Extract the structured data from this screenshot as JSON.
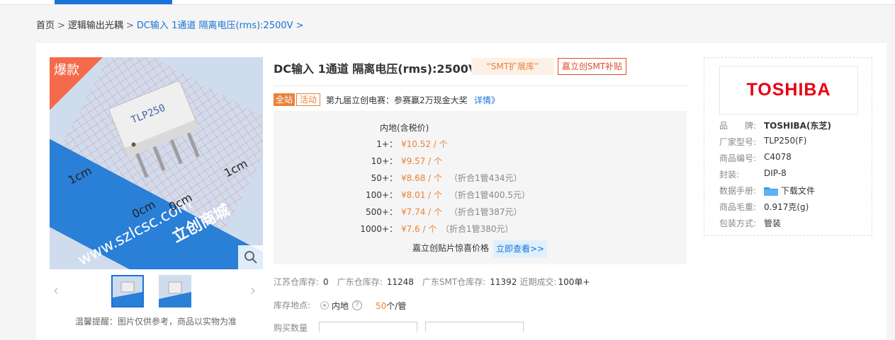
{
  "breadcrumb": {
    "home": "首页",
    "category": "逻辑输出光耦",
    "current": "DC输入 1通道 隔离电压(rms):2500V",
    "sep": ">"
  },
  "product": {
    "title": "DC输入 1通道 隔离电压(rms):2500V",
    "tag_smt": "“SMT扩展库”",
    "tag_subsidy": "嘉立创SMT补贴",
    "hot_badge": "爆款",
    "image_note": "温馨提醒：图片仅供参考，商品以实物为准",
    "image_watermark": "www.szlcsc.com",
    "image_watermark_cn": "立创商城",
    "chip_marking": "TLP250",
    "ruler_labels": [
      "1cm",
      "0cm",
      "0cm",
      "1cm"
    ]
  },
  "promo": {
    "all_site": "全站",
    "activity": "活动",
    "text": "第九届立创电赛：参赛赢2万现金大奖",
    "link": "详情》"
  },
  "pricing": {
    "header": "内地(含税价)",
    "tiers": [
      {
        "qty": "1+：",
        "price": "¥10.52 / 个",
        "pack": ""
      },
      {
        "qty": "10+：",
        "price": "¥9.57 / 个",
        "pack": ""
      },
      {
        "qty": "50+：",
        "price": "¥8.68 / 个",
        "pack": "（折合1管434元）"
      },
      {
        "qty": "100+：",
        "price": "¥8.01 / 个",
        "pack": "（折合1管400.5元）"
      },
      {
        "qty": "500+：",
        "price": "¥7.74 / 个",
        "pack": "（折合1管387元）"
      },
      {
        "qty": "1000+：",
        "price": "¥7.6 / 个",
        "pack": "（折合1管380元）"
      }
    ],
    "smt_text": "嘉立创贴片惊喜价格",
    "smt_button": "立即查看>>"
  },
  "stock": {
    "jiangsu_label": "江苏仓库存:",
    "jiangsu_value": "0",
    "guangdong_label": "广东仓库存:",
    "guangdong_value": "11248",
    "gd_smt_label": "广东SMT仓库存:",
    "gd_smt_value": "11392",
    "recent_label": "近期成交:",
    "recent_value": "100单+"
  },
  "location": {
    "label": "库存地点:",
    "value": "内地",
    "help": "?",
    "pack_num": "50",
    "pack_unit": "个/管"
  },
  "buy": {
    "label": "购买数量"
  },
  "brand_panel": {
    "logo": "TOSHIBA",
    "attributes": [
      {
        "key": "品　　牌:",
        "value": "TOSHIBA(东芝)"
      },
      {
        "key": "厂家型号:",
        "value": "TLP250(F)"
      },
      {
        "key": "商品编号:",
        "value": "C4078"
      },
      {
        "key": "封装:",
        "value": "DIP-8"
      },
      {
        "key": "数据手册:",
        "value": "下载文件"
      },
      {
        "key": "商品毛重:",
        "value": "0.917克(g)"
      },
      {
        "key": "包装方式:",
        "value": "管装"
      }
    ]
  },
  "colors": {
    "accent_blue": "#1a73d8",
    "price_orange": "#e8833a",
    "brand_red": "#e60012"
  }
}
